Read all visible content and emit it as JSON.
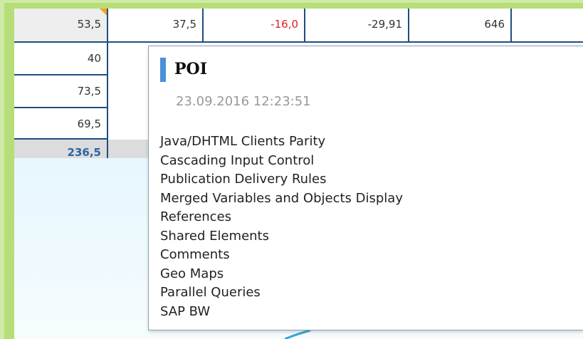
{
  "table": {
    "rows": [
      [
        "53,5",
        "37,5",
        "-16,0",
        "-29,91",
        "646"
      ],
      [
        "40"
      ],
      [
        "73,5"
      ],
      [
        "69,5"
      ]
    ],
    "total": "236,5"
  },
  "tooltip": {
    "title": "POI",
    "timestamp": "23.09.2016 12:23:51",
    "items": [
      "Java/DHTML Clients Parity",
      "Cascading Input Control",
      "Publication Delivery Rules",
      "Merged Variables and Objects Display",
      "References",
      "Shared Elements",
      "Comments",
      "Geo Maps",
      "Parallel Queries",
      "SAP BW"
    ]
  },
  "colors": {
    "accent": "#4a90d9",
    "negative_value": "#e02020",
    "total_value": "#2c64a8",
    "highlight_border": "#b7dd78"
  }
}
